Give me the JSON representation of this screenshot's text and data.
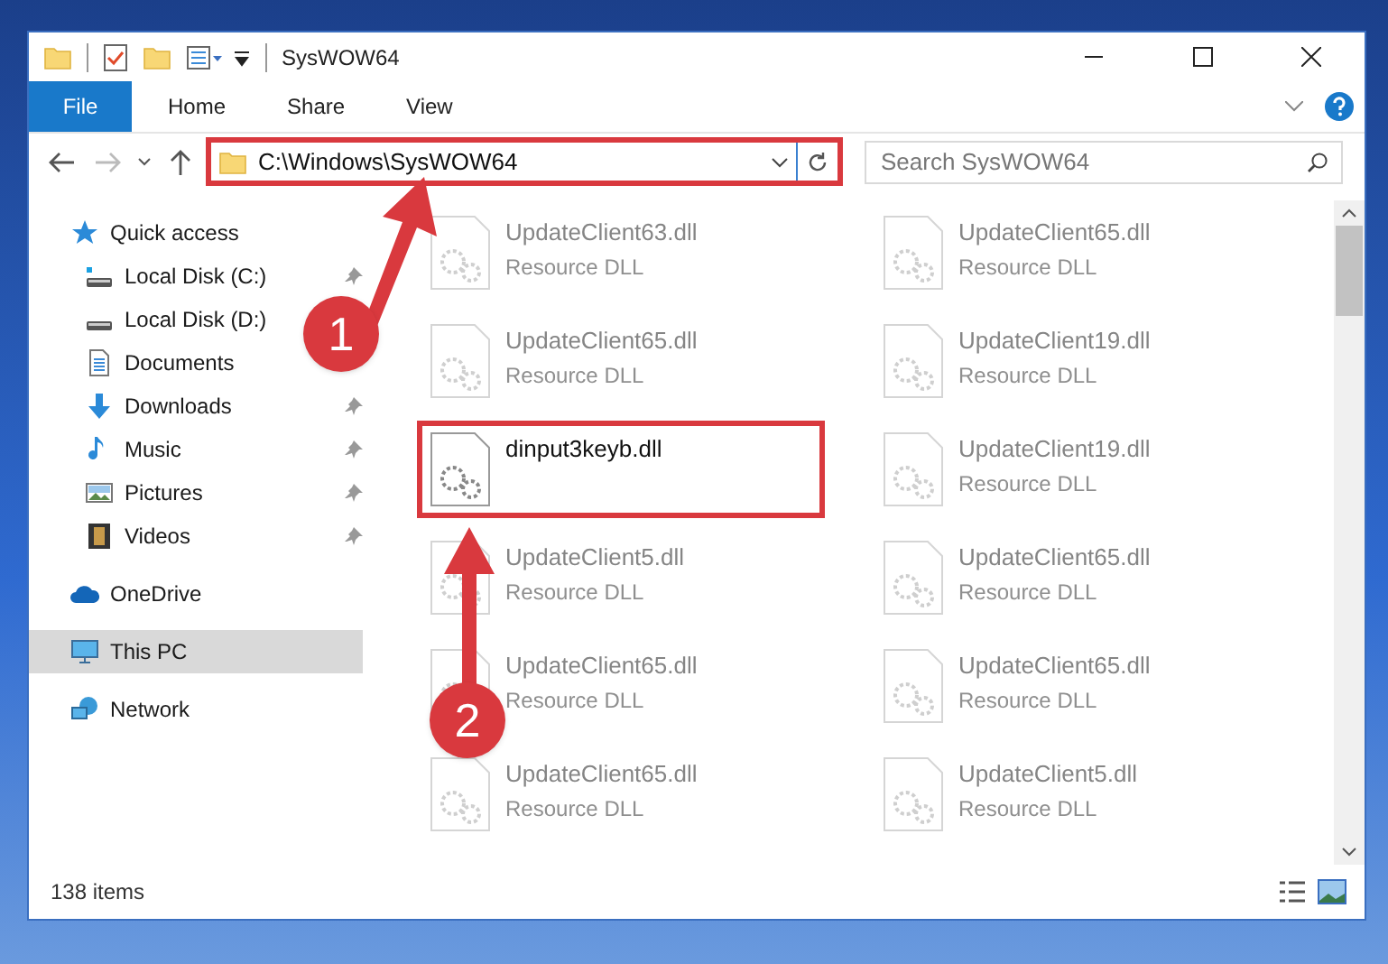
{
  "window": {
    "title": "SysWOW64"
  },
  "ribbon_tabs": [
    {
      "label": "File",
      "selected": true
    },
    {
      "label": "Home",
      "selected": false
    },
    {
      "label": "Share",
      "selected": false
    },
    {
      "label": "View",
      "selected": false
    }
  ],
  "address": {
    "path": "C:\\Windows\\SysWOW64",
    "highlighted": true
  },
  "search": {
    "placeholder": "Search SysWOW64"
  },
  "sidebar": {
    "items": [
      {
        "label": "Quick access",
        "kind": "star",
        "selected": false,
        "children": [
          {
            "label": "Local Disk (C:)",
            "kind": "windows-drive",
            "selected": false,
            "pinned": true
          },
          {
            "label": "Local Disk (D:)",
            "kind": "drive",
            "selected": false
          },
          {
            "label": "Documents",
            "kind": "documents",
            "selected": false
          },
          {
            "label": "Downloads",
            "kind": "downloads",
            "selected": false,
            "pinned": true
          },
          {
            "label": "Music",
            "kind": "music",
            "selected": false,
            "pinned": true
          },
          {
            "label": "Pictures",
            "kind": "pictures",
            "selected": false,
            "pinned": true
          },
          {
            "label": "Videos",
            "kind": "videos",
            "selected": false,
            "pinned": true
          }
        ]
      },
      {
        "label": "OneDrive",
        "kind": "cloud",
        "selected": false
      },
      {
        "label": "This PC",
        "kind": "pc",
        "selected": true
      },
      {
        "label": "Network",
        "kind": "network",
        "selected": false
      }
    ]
  },
  "files": [
    {
      "name": "UpdateClient63.dll",
      "type": "Resource DLL",
      "blurred": true,
      "highlighted": false
    },
    {
      "name": "UpdateClient65.dll",
      "type": "Resource DLL",
      "blurred": true,
      "highlighted": false
    },
    {
      "name": "UpdateClient65.dll",
      "type": "Resource DLL",
      "blurred": true,
      "highlighted": false
    },
    {
      "name": "UpdateClient19.dll",
      "type": "Resource DLL",
      "blurred": true,
      "highlighted": false
    },
    {
      "name": "dinput3keyb.dll",
      "blurred": false,
      "highlighted": true
    },
    {
      "name": "UpdateClient19.dll",
      "type": "Resource DLL",
      "blurred": true,
      "highlighted": false
    },
    {
      "name": "UpdateClient5.dll",
      "type": "Resource DLL",
      "blurred": true,
      "highlighted": false
    },
    {
      "name": "UpdateClient65.dll",
      "type": "Resource DLL",
      "blurred": true,
      "highlighted": false
    },
    {
      "name": "UpdateClient65.dll",
      "type": "Resource DLL",
      "blurred": true,
      "highlighted": false
    },
    {
      "name": "UpdateClient65.dll",
      "type": "Resource DLL",
      "blurred": true,
      "highlighted": false
    },
    {
      "name": "UpdateClient65.dll",
      "type": "Resource DLL",
      "blurred": true,
      "highlighted": false
    },
    {
      "name": "UpdateClient5.dll",
      "type": "Resource DLL",
      "blurred": true,
      "highlighted": false
    }
  ],
  "status_bar": {
    "items_count": "138 items"
  },
  "annotations": [
    {
      "label": "1"
    },
    {
      "label": "2"
    }
  ]
}
